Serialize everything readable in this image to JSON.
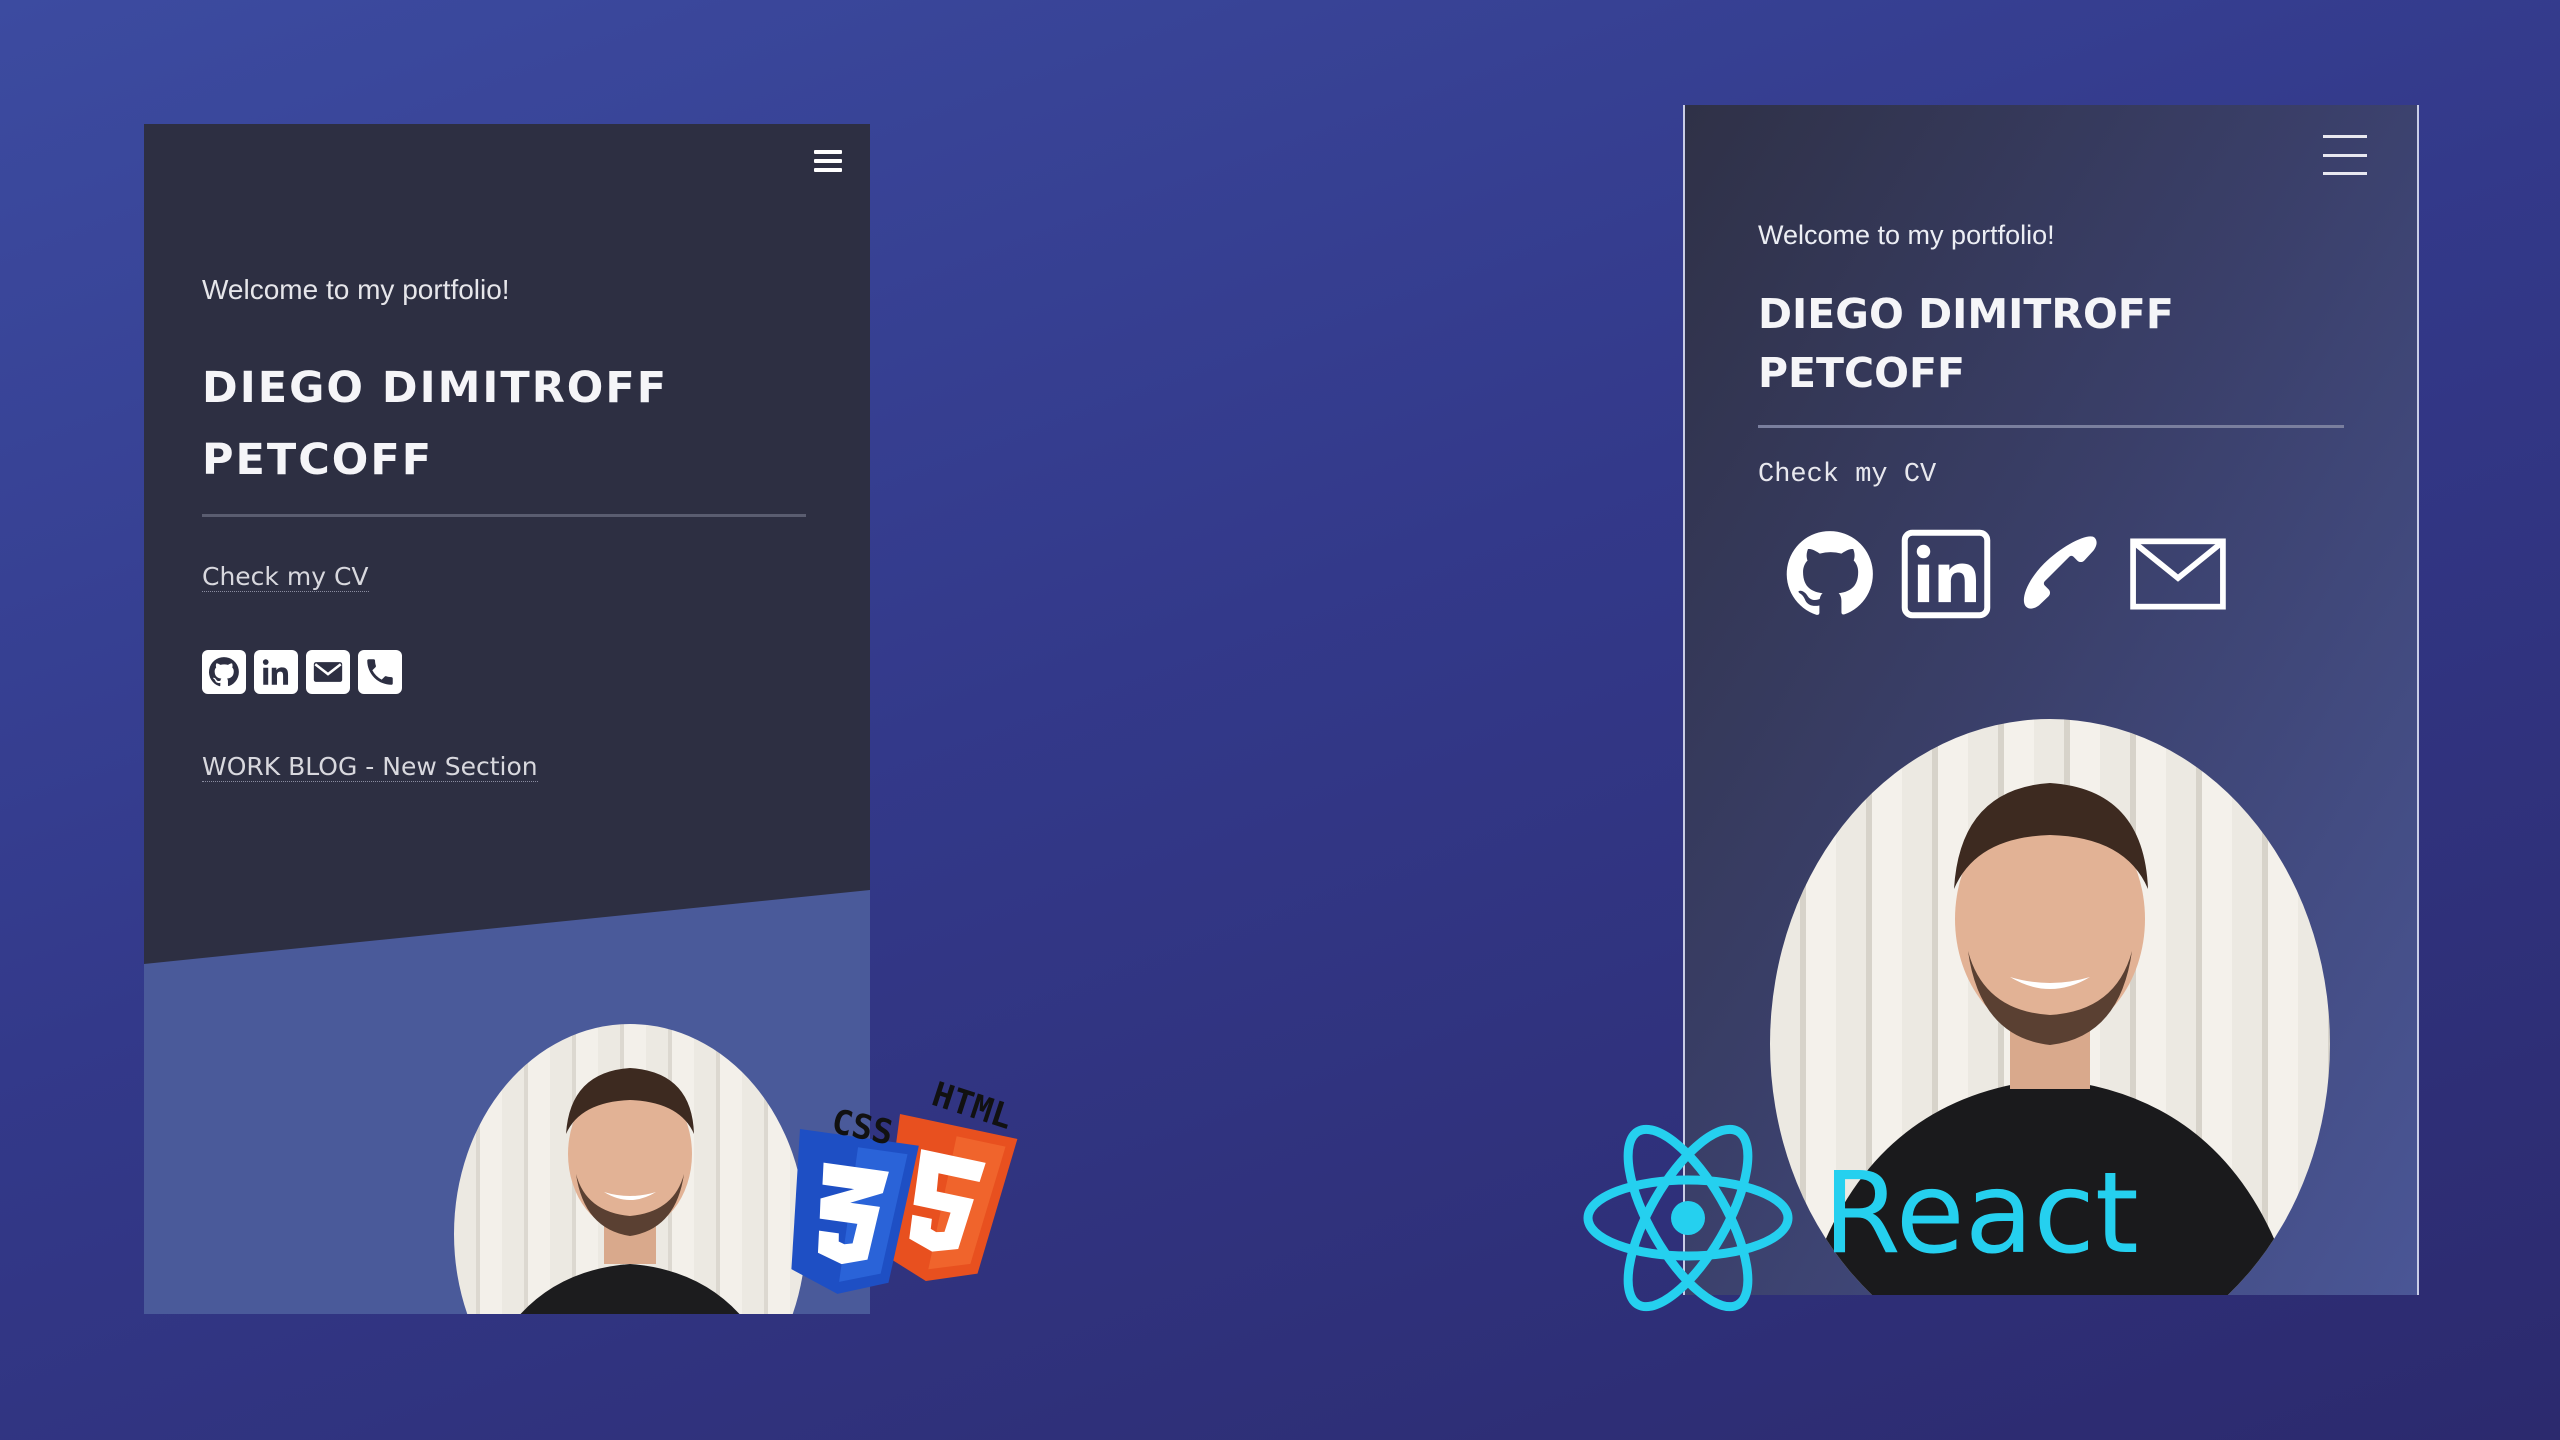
{
  "left_phone": {
    "menu_icon": "hamburger-icon",
    "welcome": "Welcome to my portfolio!",
    "name_line1": "DIEGO DIMITROFF",
    "name_line2": "PETCOFF",
    "cv_link": "Check my CV",
    "social_icons": [
      "github-icon",
      "linkedin-icon",
      "mail-icon",
      "phone-icon"
    ],
    "blog_link": "WORK BLOG - New Section",
    "colors": {
      "dark_bg": "#2d2f42",
      "accent_bg": "#4a5a9a",
      "text": "#f5f5f8"
    }
  },
  "right_phone": {
    "menu_icon": "hamburger-icon",
    "welcome": "Welcome to my portfolio!",
    "name_line1": "DIEGO DIMITROFF",
    "name_line2": "PETCOFF",
    "cv_link": "Check my CV",
    "social_icons": [
      "github-icon",
      "linkedin-icon",
      "phone-icon",
      "mail-icon"
    ]
  },
  "logos": {
    "css_label": "CSS",
    "html_label": "HTML",
    "react_label": "React",
    "colors": {
      "css": "#2a63d8",
      "html": "#e8501f",
      "react": "#25d0ef"
    }
  }
}
